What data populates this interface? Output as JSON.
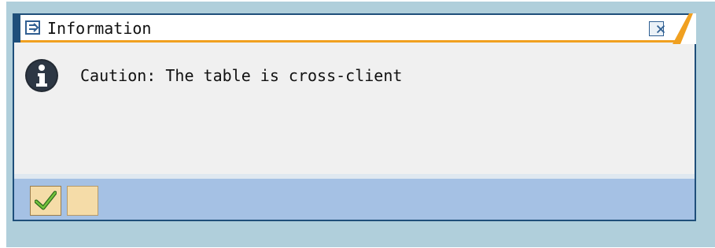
{
  "dialog": {
    "title": "Information",
    "icon": "window-icon",
    "close_icon": "close-icon",
    "accent_color": "#1f4f7a",
    "highlight_color": "#f0a020"
  },
  "message": {
    "icon": "info-icon",
    "text": "Caution: The table is cross-client"
  },
  "footer": {
    "buttons": [
      {
        "icon": "checkmark-icon"
      },
      {
        "icon": ""
      }
    ],
    "bar_color": "#a5c1e4"
  }
}
